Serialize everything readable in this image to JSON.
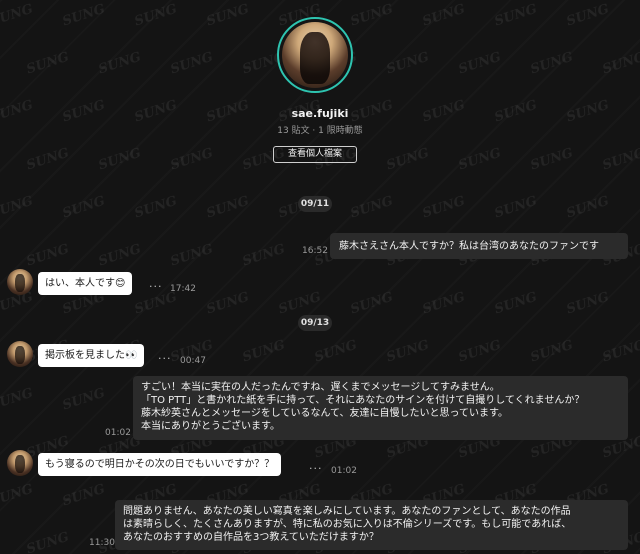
{
  "profile": {
    "username": "sae.fujiki",
    "stats": "13 貼文 · 1 限時動態",
    "view_profile_label": "查看個人檔案"
  },
  "dates": [
    "09/11",
    "09/13"
  ],
  "messages": [
    {
      "from": "me",
      "text": "藤木さえさん本人ですか？私は台湾のあなたのファンです",
      "time": "16:52"
    },
    {
      "from": "them",
      "text": "はい、本人です",
      "emoji": "😊",
      "time": "17:42"
    },
    {
      "from": "them",
      "text": "掲示板を見ました",
      "emoji": "👀",
      "time": "00:47"
    },
    {
      "from": "me",
      "lines": [
        "すごい！本当に実在の人だったんですね、遅くまでメッセージしてすみません。",
        "「TO PTT」と書かれた紙を手に持って、それにあなたのサインを付けて自撮りしてくれませんか？",
        "藤木紗英さんとメッセージをしているなんて、友達に自慢したいと思っています。",
        "本当にありがとうございます。"
      ],
      "time": "01:02"
    },
    {
      "from": "them",
      "text": "もう寝るので明日かその次の日でもいいですか？？",
      "time": "01:02"
    },
    {
      "from": "me",
      "lines": [
        "問題ありません、あなたの美しい寫真を楽しみにしています。あなたのファンとして、あなたの作品",
        "は素晴らしく、たくさんありますが、特に私のお気に入りは不倫シリーズです。もし可能であれば、",
        "あなたのおすすめの自作品を3つ教えていただけますか？"
      ],
      "time": "11:30"
    }
  ],
  "more_icon": "···",
  "watermark": "SUNG",
  "colors": {
    "accent_ring": "#2ec4b0",
    "outgoing_bubble": "#2b2b2b",
    "incoming_bubble": "#ffffff",
    "background": "#141414"
  }
}
